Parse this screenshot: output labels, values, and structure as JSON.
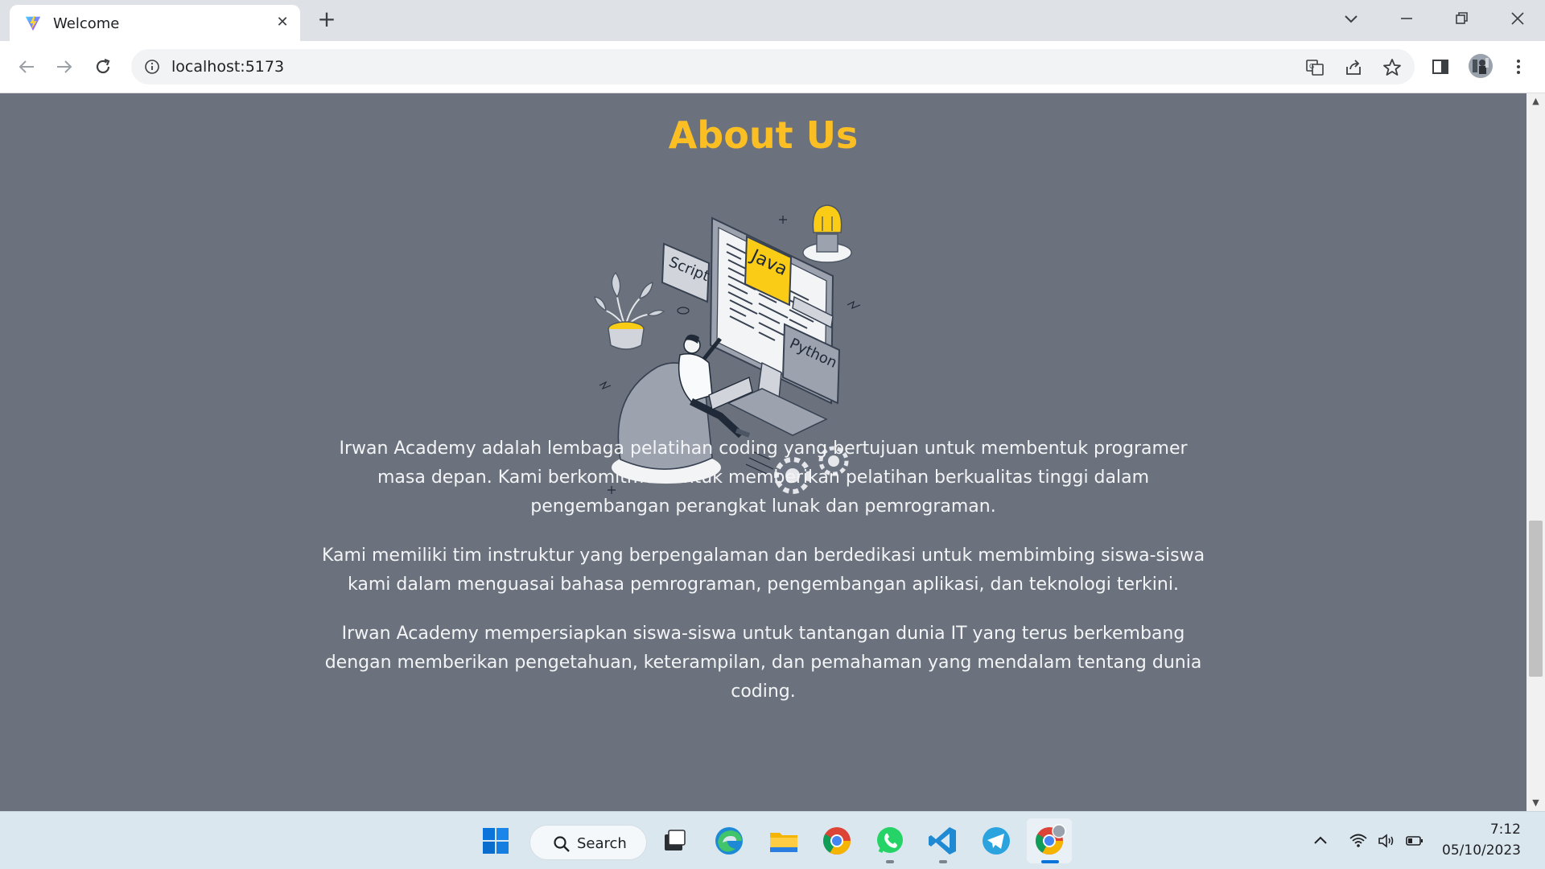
{
  "browser": {
    "tab_title": "Welcome",
    "url": "localhost:5173",
    "new_tab_symbol": "+",
    "tab_close_symbol": "✕"
  },
  "page": {
    "heading": "About Us",
    "illustration": {
      "labels": [
        "Java",
        "Script",
        "Python"
      ]
    },
    "paragraphs": [
      "Irwan Academy adalah lembaga pelatihan coding yang bertujuan untuk membentuk programer masa depan. Kami berkomitmen untuk memberikan pelatihan berkualitas tinggi dalam pengembangan perangkat lunak dan pemrograman.",
      "Kami memiliki tim instruktur yang berpengalaman dan berdedikasi untuk membimbing siswa-siswa kami dalam menguasai bahasa pemrograman, pengembangan aplikasi, dan teknologi terkini.",
      "Irwan Academy mempersiapkan siswa-siswa untuk tantangan dunia IT yang terus berkembang dengan memberikan pengetahuan, keterampilan, dan pemahaman yang mendalam tentang dunia coding."
    ],
    "colors": {
      "background": "#6b727d",
      "heading": "#fbbf24",
      "text": "#f3f4f6"
    }
  },
  "taskbar": {
    "search_label": "Search",
    "apps": [
      "start-icon",
      "search",
      "task-view-icon",
      "edge-icon",
      "file-explorer-icon",
      "chrome-icon",
      "whatsapp-icon",
      "vscode-icon",
      "telegram-icon",
      "chrome-profile-icon"
    ],
    "time": "7:12",
    "date": "05/10/2023"
  }
}
